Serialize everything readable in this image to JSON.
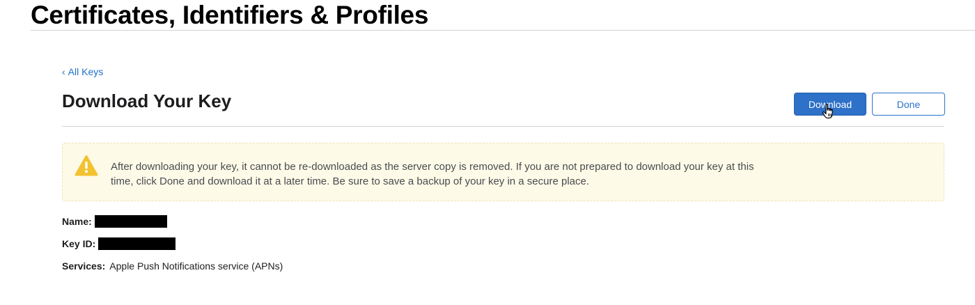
{
  "header": {
    "title": "Certificates, Identifiers & Profiles"
  },
  "nav": {
    "back_label": "All Keys"
  },
  "page": {
    "heading": "Download Your Key"
  },
  "actions": {
    "download_label": "Download",
    "done_label": "Done"
  },
  "alert": {
    "icon": "warning-icon",
    "message": "After downloading your key, it cannot be re-downloaded as the server copy is removed. If you are not prepared to download your key at this time, click Done and download it at a later time. Be sure to save a backup of your key in a secure place."
  },
  "details": {
    "name_label": "Name:",
    "key_id_label": "Key ID:",
    "services_label": "Services:",
    "services_value": "Apple Push Notifications service (APNs)"
  },
  "colors": {
    "accent": "#2d71c8",
    "link": "#1f6fc7",
    "alert_bg": "#fdfbe8",
    "warning": "#f2c230"
  }
}
